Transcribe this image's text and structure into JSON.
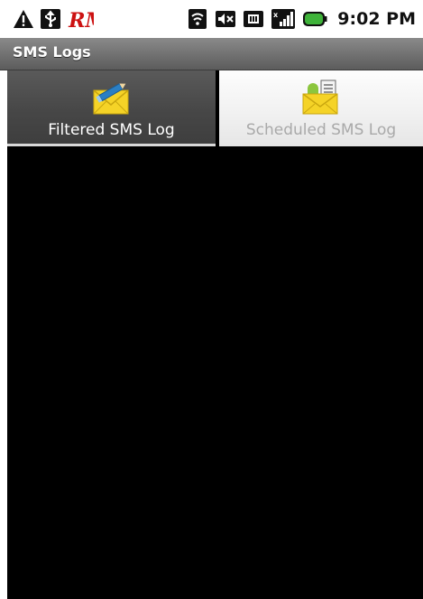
{
  "status_bar": {
    "time": "9:02 PM",
    "left_icons": [
      "warning-icon",
      "usb-icon",
      "rm-app-icon"
    ],
    "right_icons": [
      "wifi-icon",
      "volume-muted-icon",
      "sd-card-icon",
      "signal-icon",
      "battery-icon"
    ]
  },
  "app": {
    "title": "SMS Logs"
  },
  "tabs": [
    {
      "label": "Filtered SMS Log",
      "selected": true,
      "icon": "filtered-envelope-icon"
    },
    {
      "label": "Scheduled SMS Log",
      "selected": false,
      "icon": "scheduled-envelope-icon"
    }
  ],
  "colors": {
    "title_bar": "#6e6e6e",
    "selected_tab": "#474747",
    "unselected_tab": "#f0f0f0",
    "content_background": "#000000",
    "envelope": "#f5d327",
    "pencil": "#2b7fc4",
    "android_green": "#8cc63e",
    "battery_green": "#3fb33a"
  }
}
